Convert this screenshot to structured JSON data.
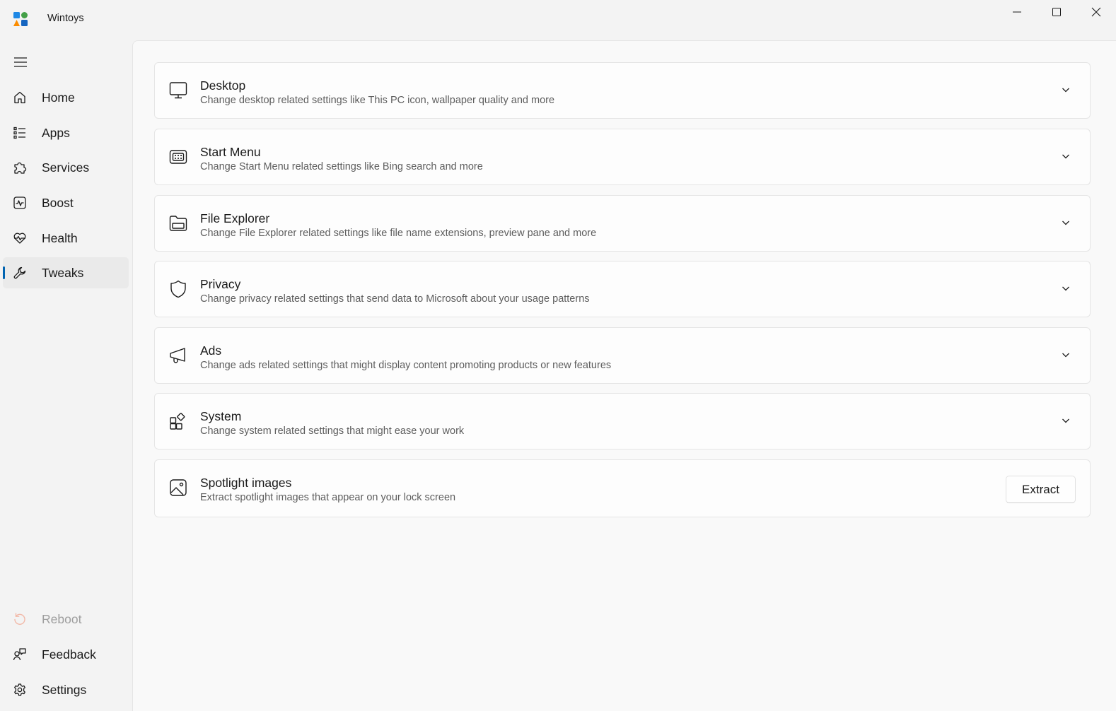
{
  "window": {
    "title": "Wintoys"
  },
  "sidebar": {
    "items": [
      {
        "label": "Home",
        "icon": "home-icon"
      },
      {
        "label": "Apps",
        "icon": "apps-list-icon"
      },
      {
        "label": "Services",
        "icon": "puzzle-icon"
      },
      {
        "label": "Boost",
        "icon": "pulse-icon"
      },
      {
        "label": "Health",
        "icon": "heart-pulse-icon"
      },
      {
        "label": "Tweaks",
        "icon": "wrench-icon",
        "selected": true
      }
    ],
    "footer": [
      {
        "label": "Reboot",
        "icon": "restart-icon",
        "disabled": true
      },
      {
        "label": "Feedback",
        "icon": "feedback-icon"
      },
      {
        "label": "Settings",
        "icon": "gear-icon"
      }
    ]
  },
  "tweaks": {
    "cards": [
      {
        "title": "Desktop",
        "subtitle": "Change desktop related settings like This PC icon, wallpaper quality and more",
        "icon": "monitor-icon"
      },
      {
        "title": "Start Menu",
        "subtitle": "Change Start Menu related settings like Bing search and more",
        "icon": "start-menu-icon"
      },
      {
        "title": "File Explorer",
        "subtitle": "Change File Explorer related settings like file name extensions, preview pane and more",
        "icon": "folder-icon"
      },
      {
        "title": "Privacy",
        "subtitle": "Change privacy related settings that send data to Microsoft about your usage patterns",
        "icon": "shield-icon"
      },
      {
        "title": "Ads",
        "subtitle": "Change ads related settings that might display content promoting products or new features",
        "icon": "megaphone-icon"
      },
      {
        "title": "System",
        "subtitle": "Change system related settings that might ease your work",
        "icon": "system-apps-icon"
      },
      {
        "title": "Spotlight images",
        "subtitle": "Extract spotlight images that appear on your lock screen",
        "icon": "image-icon",
        "action_label": "Extract"
      }
    ]
  },
  "colors": {
    "accent": "#0063b1",
    "window_bg": "#f3f3f3",
    "content_bg": "#f9f9f9",
    "card_bg": "#fdfdfd",
    "secondary_text": "#5d5d5d",
    "disabled_text": "#9e9e9e"
  }
}
